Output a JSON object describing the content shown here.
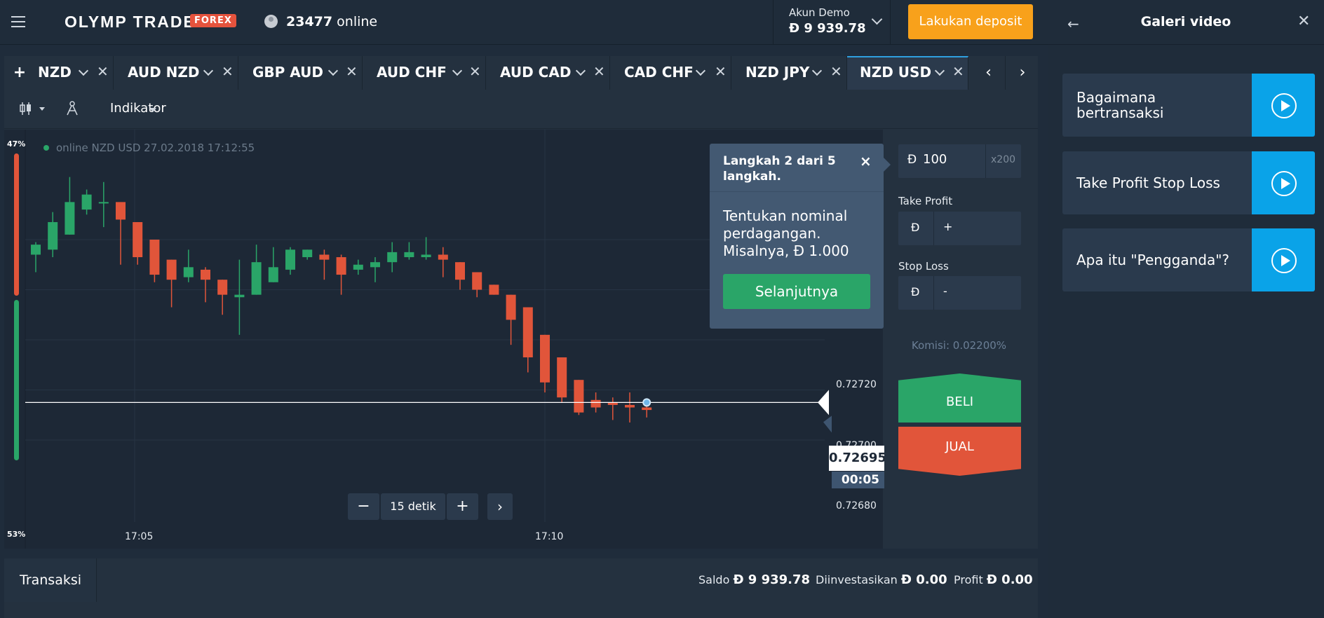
{
  "header": {
    "brand": "OLYMP TRADE",
    "brand_badge": "FOREX",
    "online_count": "23477",
    "online_label": "online",
    "account_type": "Akun Demo",
    "account_balance": "Đ 9 939.78",
    "deposit_label": "Lakukan deposit"
  },
  "right_panel": {
    "title": "Galeri video",
    "videos": [
      {
        "title": "Bagaimana bertransaksi"
      },
      {
        "title": "Take Profit Stop Loss"
      },
      {
        "title": "Apa itu \"Pengganda\"?"
      }
    ]
  },
  "tabs": {
    "add": "+",
    "items": [
      {
        "label": "NZD"
      },
      {
        "label": "AUD NZD"
      },
      {
        "label": "GBP AUD"
      },
      {
        "label": "AUD CHF"
      },
      {
        "label": "AUD CAD"
      },
      {
        "label": "CAD CHF"
      },
      {
        "label": "NZD JPY"
      },
      {
        "label": "NZD USD",
        "active": true
      }
    ],
    "prev": "‹",
    "next": "›"
  },
  "toolbar": {
    "indicator_label": "Indikator"
  },
  "chart": {
    "status_text": "online NZD USD  27.02.2018 17:12:55",
    "sentiment_up": "47%",
    "sentiment_down": "53%",
    "sentiment_up_value": 47,
    "sentiment_down_value": 53,
    "current_price": "0.72695",
    "timer": "00:05",
    "zoom_label": "15 detik",
    "zoom_minus": "−",
    "zoom_plus": "+",
    "zoom_next": "›"
  },
  "chart_data": {
    "type": "candlestick",
    "title": "",
    "price_ticks": [
      "0.72720",
      "0.72700",
      "0.72680"
    ],
    "time_ticks": [
      "17:05",
      "17:10"
    ],
    "current_price": 0.72695,
    "candles": [
      {
        "o": 0.72754,
        "h": 0.72759,
        "l": 0.72747,
        "c": 0.72758
      },
      {
        "o": 0.72756,
        "h": 0.72771,
        "l": 0.72753,
        "c": 0.72767
      },
      {
        "o": 0.72762,
        "h": 0.72785,
        "l": 0.72762,
        "c": 0.72775
      },
      {
        "o": 0.72772,
        "h": 0.7278,
        "l": 0.7277,
        "c": 0.72778
      },
      {
        "o": 0.72775,
        "h": 0.72783,
        "l": 0.72765,
        "c": 0.72775
      },
      {
        "o": 0.72775,
        "h": 0.72771,
        "l": 0.7275,
        "c": 0.72768
      },
      {
        "o": 0.72767,
        "h": 0.72767,
        "l": 0.7275,
        "c": 0.72753
      },
      {
        "o": 0.7276,
        "h": 0.7276,
        "l": 0.72743,
        "c": 0.72746
      },
      {
        "o": 0.72752,
        "h": 0.72752,
        "l": 0.72733,
        "c": 0.72744
      },
      {
        "o": 0.72745,
        "h": 0.72756,
        "l": 0.72743,
        "c": 0.72749
      },
      {
        "o": 0.72748,
        "h": 0.72749,
        "l": 0.72735,
        "c": 0.72744
      },
      {
        "o": 0.72744,
        "h": 0.72744,
        "l": 0.7273,
        "c": 0.72738
      },
      {
        "o": 0.72737,
        "h": 0.72752,
        "l": 0.72722,
        "c": 0.72738
      },
      {
        "o": 0.72738,
        "h": 0.72758,
        "l": 0.72738,
        "c": 0.72751
      },
      {
        "o": 0.72743,
        "h": 0.72757,
        "l": 0.72743,
        "c": 0.72749
      },
      {
        "o": 0.72748,
        "h": 0.72757,
        "l": 0.72746,
        "c": 0.72756
      },
      {
        "o": 0.72753,
        "h": 0.72756,
        "l": 0.72752,
        "c": 0.72756
      },
      {
        "o": 0.72754,
        "h": 0.72756,
        "l": 0.72744,
        "c": 0.72752
      },
      {
        "o": 0.72753,
        "h": 0.72754,
        "l": 0.72738,
        "c": 0.72746
      },
      {
        "o": 0.72748,
        "h": 0.72752,
        "l": 0.72746,
        "c": 0.7275
      },
      {
        "o": 0.72749,
        "h": 0.72753,
        "l": 0.72743,
        "c": 0.72751
      },
      {
        "o": 0.72751,
        "h": 0.72759,
        "l": 0.72747,
        "c": 0.72755
      },
      {
        "o": 0.72753,
        "h": 0.72759,
        "l": 0.72752,
        "c": 0.72755
      },
      {
        "o": 0.72753,
        "h": 0.72761,
        "l": 0.72752,
        "c": 0.72754
      },
      {
        "o": 0.72754,
        "h": 0.72757,
        "l": 0.72745,
        "c": 0.72752
      },
      {
        "o": 0.72751,
        "h": 0.72751,
        "l": 0.7274,
        "c": 0.72744
      },
      {
        "o": 0.72747,
        "h": 0.72747,
        "l": 0.72737,
        "c": 0.7274
      },
      {
        "o": 0.72742,
        "h": 0.72742,
        "l": 0.72738,
        "c": 0.72738
      },
      {
        "o": 0.72738,
        "h": 0.72738,
        "l": 0.72718,
        "c": 0.72728
      },
      {
        "o": 0.72733,
        "h": 0.72733,
        "l": 0.72707,
        "c": 0.72713
      },
      {
        "o": 0.72722,
        "h": 0.72722,
        "l": 0.72699,
        "c": 0.72703
      },
      {
        "o": 0.72713,
        "h": 0.72713,
        "l": 0.72695,
        "c": 0.72697
      },
      {
        "o": 0.72704,
        "h": 0.72704,
        "l": 0.7269,
        "c": 0.72691
      },
      {
        "o": 0.72696,
        "h": 0.72699,
        "l": 0.72691,
        "c": 0.72693
      },
      {
        "o": 0.72695,
        "h": 0.72697,
        "l": 0.72688,
        "c": 0.72694
      },
      {
        "o": 0.72694,
        "h": 0.72699,
        "l": 0.72687,
        "c": 0.72693
      },
      {
        "o": 0.72693,
        "h": 0.72695,
        "l": 0.72689,
        "c": 0.72692
      }
    ]
  },
  "tooltip": {
    "heading": "Langkah 2 dari 5 langkah.",
    "close": "×",
    "body": "Tentukan nominal perdagangan. Misalnya, Đ 1.000",
    "next_label": "Selanjutnya"
  },
  "order": {
    "currency": "Đ",
    "amount": "100",
    "multiplier": "x200",
    "take_profit_label": "Take Profit",
    "take_profit_value": "+",
    "stop_loss_label": "Stop Loss",
    "stop_loss_value": "-",
    "commission": "Komisi: 0.02200%",
    "buy_label": "BELI",
    "sell_label": "JUAL"
  },
  "bottom": {
    "tab_label": "Transaksi",
    "balance_label": "Saldo",
    "balance_value": "Đ 9 939.78",
    "invested_label": "Diinvestasikan",
    "invested_value": "Đ 0.00",
    "profit_label": "Profit",
    "profit_value": "Đ 0.00"
  },
  "colors": {
    "up": "#2aa568",
    "down": "#e1553a",
    "accent": "#0aa3e8",
    "deposit": "#f8a11b"
  }
}
